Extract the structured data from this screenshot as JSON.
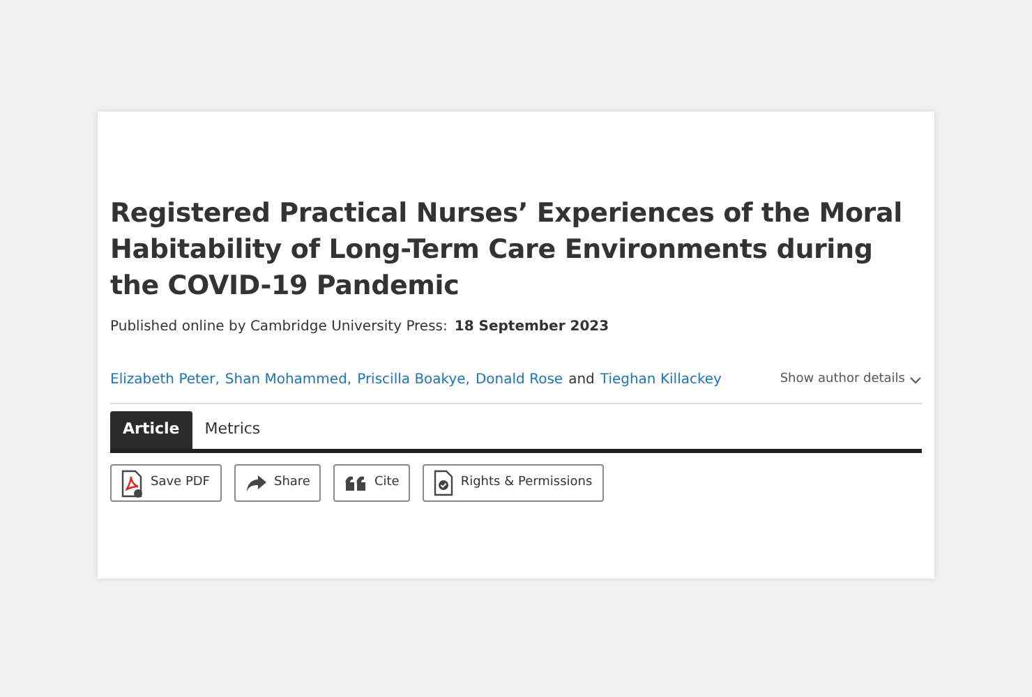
{
  "article": {
    "title": "Registered Practical Nurses’ Experiences of the Moral Habitability of Long-Term Care Environments during the COVID-19 Pandemic",
    "published_label": "Published online by Cambridge University Press:",
    "published_date": "18 September 2023",
    "authors": [
      {
        "name": "Elizabeth Peter,"
      },
      {
        "name": "Shan Mohammed,"
      },
      {
        "name": "Priscilla Boakye,"
      },
      {
        "name": "Donald Rose"
      },
      {
        "name": "Tieghan Killackey"
      }
    ],
    "conjunction": "and",
    "author_details": "Show author details",
    "tabs": [
      {
        "label": "Article",
        "selected": true
      },
      {
        "label": "Metrics",
        "selected": false
      }
    ],
    "actions": [
      {
        "kind": "pdf",
        "label": "Save PDF"
      },
      {
        "kind": "share",
        "label": "Share"
      },
      {
        "kind": "cite",
        "label": "Cite"
      },
      {
        "kind": "rights",
        "label": "Rights & Permissions"
      }
    ]
  }
}
